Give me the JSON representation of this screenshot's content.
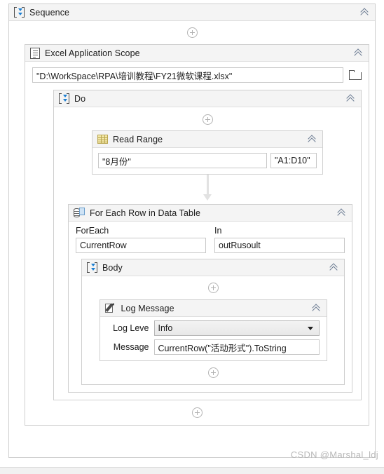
{
  "workflow": {
    "sequence": {
      "title": "Sequence",
      "icon": "sequence-icon",
      "collapse_icon": "double-chevron-up-icon"
    },
    "excel_scope": {
      "title": "Excel Application Scope",
      "icon": "document-icon",
      "workbook_path": "\"D:\\WorkSpace\\RPA\\培训教程\\FY21微软课程.xlsx\"",
      "browse_icon": "folder-icon",
      "collapse_icon": "double-chevron-up-icon"
    },
    "do_container": {
      "title": "Do",
      "icon": "sequence-icon",
      "collapse_icon": "double-chevron-up-icon"
    },
    "read_range": {
      "title": "Read Range",
      "icon": "spreadsheet-grid-icon",
      "sheet_name": "\"8月份\"",
      "range": "\"A1:D10\"",
      "collapse_icon": "double-chevron-up-icon"
    },
    "for_each_row": {
      "title": "For Each Row in Data Table",
      "icon": "data-table-icon",
      "foreach_label": "ForEach",
      "foreach_value": "CurrentRow",
      "in_label": "In",
      "in_value": "outRusoult",
      "collapse_icon": "double-chevron-up-icon"
    },
    "body": {
      "title": "Body",
      "icon": "sequence-icon",
      "collapse_icon": "double-chevron-up-icon"
    },
    "log_message": {
      "title": "Log Message",
      "icon": "log-pencil-icon",
      "log_level_label": "Log Leve",
      "log_level_value": "Info",
      "log_level_options": [
        "Info"
      ],
      "message_label": "Message",
      "message_value": "CurrentRow(\"活动形式\").ToString",
      "dropdown_icon": "chevron-down-icon",
      "collapse_icon": "double-chevron-up-icon"
    },
    "add_activity_icon": "plus-circle-icon"
  },
  "watermark": {
    "text": "CSDN @Marshal_ldj"
  },
  "colors": {
    "accent_blue": "#1d7fd1",
    "header_bg": "#f4f4f4",
    "border": "#cfcfcf",
    "chevron": "#6b7b92",
    "connector": "#e2e2e2"
  }
}
